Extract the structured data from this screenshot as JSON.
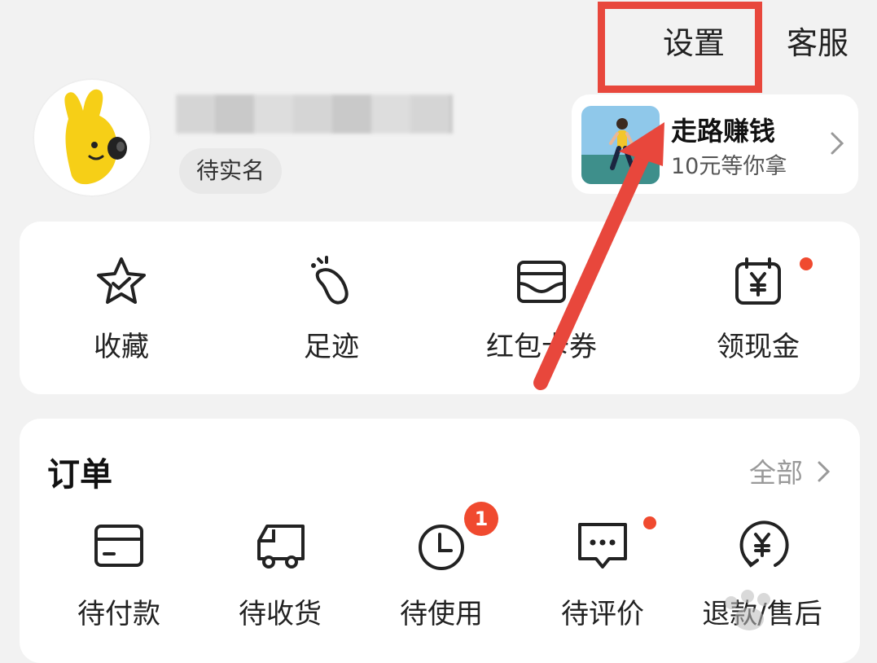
{
  "header": {
    "settings_label": "设置",
    "service_label": "客服"
  },
  "profile": {
    "verify_tag": "待实名"
  },
  "promo": {
    "title": "走路赚钱",
    "subtitle": "10元等你拿"
  },
  "quick_actions": [
    {
      "label": "收藏",
      "icon": "star-icon"
    },
    {
      "label": "足迹",
      "icon": "footprint-icon"
    },
    {
      "label": "红包卡券",
      "icon": "wallet-icon"
    },
    {
      "label": "领现金",
      "icon": "cash-calendar-icon"
    }
  ],
  "orders": {
    "title": "订单",
    "all_label": "全部",
    "items": [
      {
        "label": "待付款",
        "icon": "card-icon"
      },
      {
        "label": "待收货",
        "icon": "truck-icon"
      },
      {
        "label": "待使用",
        "icon": "clock-icon",
        "badge": "1"
      },
      {
        "label": "待评价",
        "icon": "comment-icon"
      },
      {
        "label": "退款/售后",
        "icon": "refund-icon"
      }
    ]
  },
  "colors": {
    "accent_red": "#e8473c",
    "badge_red": "#f04a2f",
    "background": "#f2f2f2"
  }
}
